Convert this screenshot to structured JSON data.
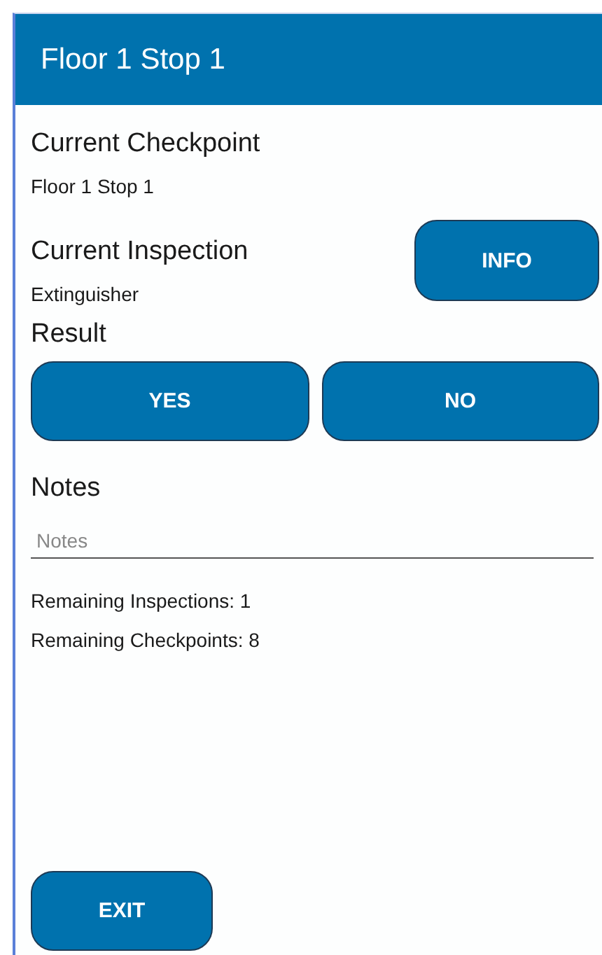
{
  "app_bar": {
    "title": "Floor 1 Stop 1"
  },
  "checkpoint": {
    "label": "Current Checkpoint",
    "value": "Floor 1 Stop 1"
  },
  "inspection": {
    "label": "Current Inspection",
    "value": "Extinguisher",
    "button": "INFO"
  },
  "result": {
    "label": "Result",
    "buttons": [
      "YES",
      "NO"
    ]
  },
  "notes": {
    "label": "Notes",
    "placeholder": "Notes"
  },
  "counts": [
    "Remaining Inspections: 1",
    "Remaining Checkpoints: 8"
  ],
  "exit_button": "EXIT"
}
